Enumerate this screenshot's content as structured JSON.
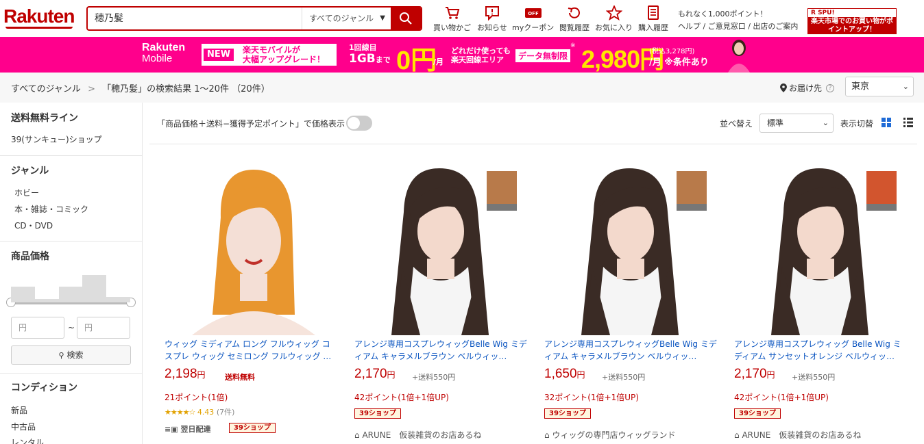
{
  "header": {
    "logo": "Rakuten",
    "search_value": "穂乃髪",
    "genre_select": "すべてのジャンル",
    "icons": [
      {
        "name": "cart-icon",
        "label": "買い物かご"
      },
      {
        "name": "notice-icon",
        "label": "お知らせ"
      },
      {
        "name": "coupon-icon",
        "label": "myクーポン"
      },
      {
        "name": "history-icon",
        "label": "閲覧履歴"
      },
      {
        "name": "star-icon",
        "label": "お気に入り"
      },
      {
        "name": "purchase-icon",
        "label": "購入履歴"
      }
    ],
    "coupon_badge": "OFF",
    "promo_line1": "もれなく1,000ポイント！",
    "promo_line2": "ヘルプ / ご意見窓口 / 出店のご案内",
    "spu_top": "R SPU!",
    "spu_body": "楽天市場でのお買い物がポイントアップ！"
  },
  "mobile_banner": {
    "logo_line1": "Rakuten",
    "logo_line2": "Mobile",
    "new_tag": "NEW",
    "new_text_line1": "楽天モバイルが",
    "new_text_line2": "大幅アップグレード！",
    "onegb_line1": "1回線目",
    "onegb_line2": "1GB",
    "onegb_made": "まで",
    "zero": "0円",
    "zero_unit": "/月",
    "area_line1": "どれだけ使っても",
    "area_line2": "楽天回線エリア",
    "unlimited": "データ無制限",
    "star": "※",
    "price": "2,980円",
    "price_tax": "(税込3,278円)",
    "price_unit": "/月 ※条件あり"
  },
  "breadcrumb": {
    "root": "すべてのジャンル",
    "separator": ">",
    "result": "「穂乃髪」の検索結果 1～20件 （20件）",
    "deliver_label": "お届け先",
    "help": "?",
    "prefecture": "東京"
  },
  "sidebar": {
    "free_shipping_heading": "送料無料ライン",
    "free_shipping_item": "39(サンキュー)ショップ",
    "genre_heading": "ジャンル",
    "genres": [
      "ホビー",
      "本・雑誌・コミック",
      "CD・DVD"
    ],
    "price_heading": "商品価格",
    "price_histogram": [
      0.45,
      0.1,
      0.45,
      0.8,
      0.15
    ],
    "price_min_placeholder": "円",
    "price_tilde": "~",
    "price_max_placeholder": "円",
    "search_button": "検索",
    "condition_heading": "コンディション",
    "conditions": [
      "新品",
      "中古品",
      "レンタル"
    ]
  },
  "toolbar": {
    "price_display_label": "「商品価格＋送料−獲得予定ポイント」で価格表示",
    "sort_label": "並べ替え",
    "sort_value": "標準",
    "view_label": "表示切替"
  },
  "products": [
    {
      "title": "ウィッグ ミディアム ロング フルウィッグ コスプレ ウィッグ セミロング フルウィッグ …",
      "price": "2,198",
      "yen": "円",
      "shipping": "送料無料",
      "points": "21ポイント(1倍)",
      "stars": "★★★★☆",
      "rating": "4.43",
      "reviews": "(7件)",
      "nextday": "翌日配達",
      "badge": "39ショップ",
      "shop": "",
      "hair_color": "#e8962f",
      "swatch": ""
    },
    {
      "title": "アレンジ専用コスプレウィッグBelle Wig ミディアム キャラメルブラウン ベルウィッ…",
      "price": "2,170",
      "yen": "円",
      "shipping": "+送料550円",
      "points": "42ポイント(1倍+1倍UP)",
      "badge": "39ショップ",
      "shop": "ARUNE　仮装雑貨のお店あるね",
      "hair_color": "#3a2b25",
      "swatch": "#b87a4a"
    },
    {
      "title": "アレンジ専用コスプレウィッグBelle Wig ミディアム キャラメルブラウン ベルウィッ…",
      "price": "1,650",
      "yen": "円",
      "shipping": "+送料550円",
      "points": "32ポイント(1倍+1倍UP)",
      "badge": "39ショップ",
      "shop": "ウィッグの専門店ウィッグランド",
      "hair_color": "#3a2b25",
      "swatch": "#b87a4a"
    },
    {
      "title": "アレンジ専用コスプレウィッグ Belle Wig ミディアム サンセットオレンジ ベルウィッ…",
      "price": "2,170",
      "yen": "円",
      "shipping": "+送料550円",
      "points": "42ポイント(1倍+1倍UP)",
      "badge": "39ショップ",
      "shop": "ARUNE　仮装雑貨のお店あるね",
      "hair_color": "#3a2b25",
      "swatch": "#d2552e"
    }
  ]
}
